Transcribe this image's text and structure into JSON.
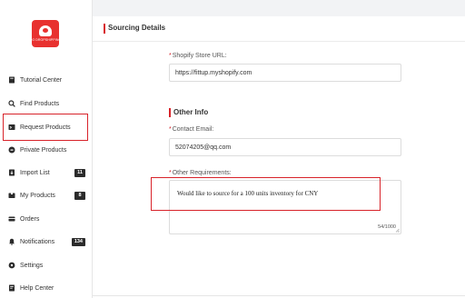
{
  "logo": {
    "text": "DO DROPSHIPPING"
  },
  "sidebar": {
    "items": [
      {
        "label": "Tutorial Center",
        "icon": "book-icon",
        "badge": ""
      },
      {
        "label": "Find Products",
        "icon": "search-icon",
        "badge": ""
      },
      {
        "label": "Request Products",
        "icon": "request-icon",
        "badge": ""
      },
      {
        "label": "Private Products",
        "icon": "private-icon",
        "badge": ""
      },
      {
        "label": "Import List",
        "icon": "import-icon",
        "badge": "11"
      },
      {
        "label": "My Products",
        "icon": "box-icon",
        "badge": "8"
      },
      {
        "label": "Orders",
        "icon": "orders-icon",
        "badge": ""
      },
      {
        "label": "Notifications",
        "icon": "bell-icon",
        "badge": "134"
      },
      {
        "label": "Settings",
        "icon": "gear-icon",
        "badge": ""
      },
      {
        "label": "Help Center",
        "icon": "help-icon",
        "badge": ""
      }
    ]
  },
  "header": {
    "title": "Sourcing Details"
  },
  "form": {
    "store_url": {
      "label": "Shopify Store URL:",
      "value": "https://fittup.myshopify.com"
    },
    "other_info_title": "Other Info",
    "contact_email": {
      "label": "Contact Email:",
      "value": "52074205@qq.com"
    },
    "other_requirements": {
      "label": "Other Requirements:",
      "value": "Would like to source for a 100 units inventory for CNY",
      "counter": "54/1000"
    }
  },
  "colors": {
    "accent": "#d8232a",
    "badge": "#2b2b2b",
    "logo": "#e8312f"
  }
}
